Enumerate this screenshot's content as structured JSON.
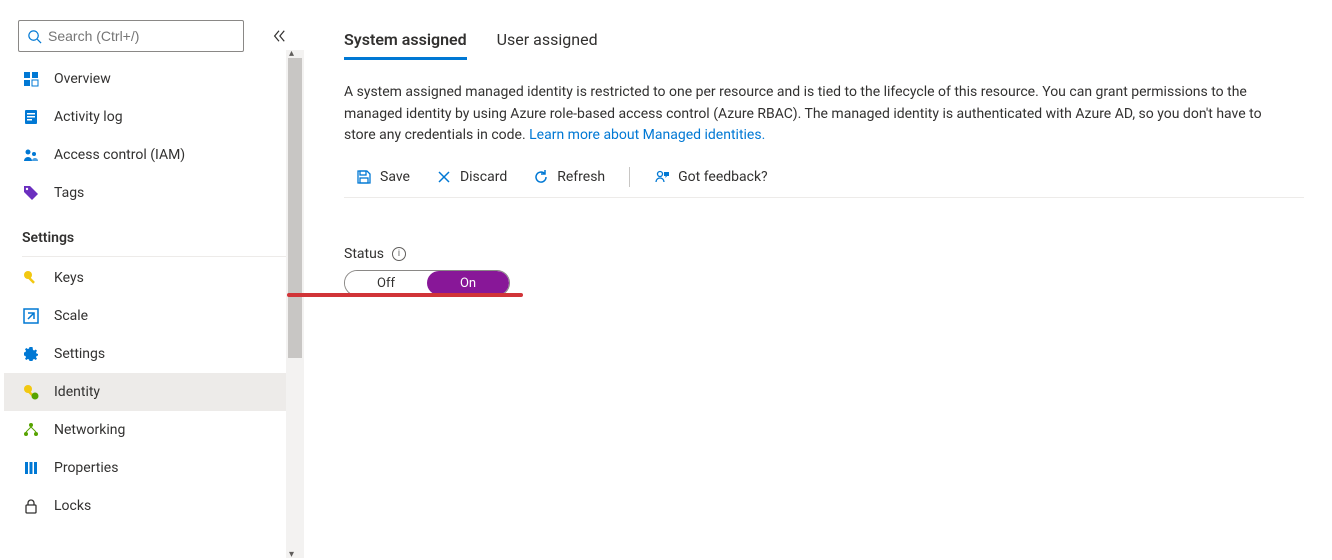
{
  "sidebar": {
    "search_placeholder": "Search (Ctrl+/)",
    "items": [
      {
        "label": "Overview"
      },
      {
        "label": "Activity log"
      },
      {
        "label": "Access control (IAM)"
      },
      {
        "label": "Tags"
      }
    ],
    "settings_heading": "Settings",
    "settings_items": [
      {
        "label": "Keys"
      },
      {
        "label": "Scale"
      },
      {
        "label": "Settings"
      },
      {
        "label": "Identity"
      },
      {
        "label": "Networking"
      },
      {
        "label": "Properties"
      },
      {
        "label": "Locks"
      }
    ]
  },
  "tabs": {
    "system_assigned": "System assigned",
    "user_assigned": "User assigned"
  },
  "description": {
    "text": "A system assigned managed identity is restricted to one per resource and is tied to the lifecycle of this resource. You can grant permissions to the managed identity by using Azure role-based access control (Azure RBAC). The managed identity is authenticated with Azure AD, so you don't have to store any credentials in code. ",
    "link": "Learn more about Managed identities."
  },
  "toolbar": {
    "save": "Save",
    "discard": "Discard",
    "refresh": "Refresh",
    "feedback": "Got feedback?"
  },
  "status": {
    "label": "Status",
    "off": "Off",
    "on": "On"
  }
}
